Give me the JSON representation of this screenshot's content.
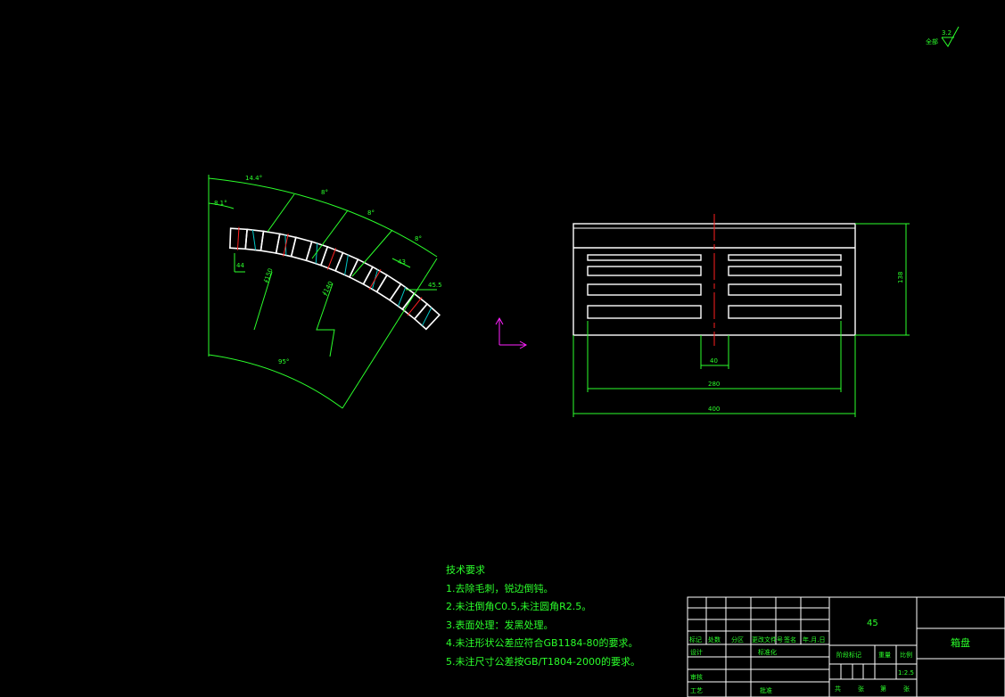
{
  "surface_finish": {
    "prefix": "全部",
    "value": "3.2"
  },
  "sector_view": {
    "dims": [
      "14.4°",
      "8.1°",
      "8°",
      "8°",
      "8°",
      "44",
      "∮150",
      "∮140",
      "43",
      "45.5",
      "95°"
    ]
  },
  "front_view": {
    "dims": {
      "height": "138",
      "slot_width": "40",
      "inner_width": "280",
      "overall_width": "400"
    }
  },
  "tech_requirements": {
    "title": "技术要求",
    "items": [
      "1.去除毛刺，锐边倒钝。",
      "2.未注倒角C0.5,未注圆角R2.5。",
      "3.表面处理：发黑处理。",
      "4.未注形状公差应符合GB1184-80的要求。",
      "5.未注尺寸公差按GB/T1804-2000的要求。"
    ]
  },
  "title_block": {
    "material": "45",
    "part_name": "箱盘",
    "revision_headers": [
      "标记",
      "处数",
      "分区",
      "更改文件号",
      "签名",
      "年.月.日"
    ],
    "design": "设计",
    "standardization": "标准化",
    "review": "审核",
    "process": "工艺",
    "approve": "批准",
    "stage_mark": "阶段标记",
    "weight": "重量",
    "scale_label": "比例",
    "scale_value": "1:2.5",
    "sheets": [
      "共",
      "张",
      "第",
      "张"
    ]
  },
  "colors": {
    "background": "#000000",
    "outline": "#ffffff",
    "dimension": "#2bff2b",
    "center_line": "#ff2020",
    "hatch": "#00c8c8",
    "ucs": "#ff22ff"
  }
}
